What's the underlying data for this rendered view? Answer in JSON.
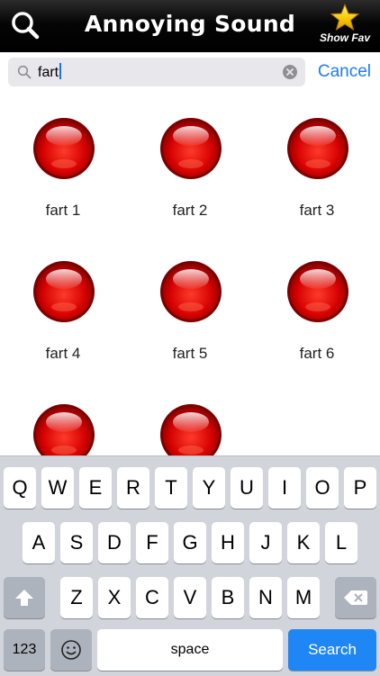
{
  "header": {
    "title": "Annoying Sound",
    "show_fav_label": "Show Fav"
  },
  "search": {
    "value": "fart",
    "cancel_label": "Cancel"
  },
  "sounds": [
    {
      "label": "fart 1"
    },
    {
      "label": "fart 2"
    },
    {
      "label": "fart 3"
    },
    {
      "label": "fart 4"
    },
    {
      "label": "fart 5"
    },
    {
      "label": "fart 6"
    },
    {
      "label": ""
    },
    {
      "label": ""
    }
  ],
  "keyboard": {
    "row1": [
      "Q",
      "W",
      "E",
      "R",
      "T",
      "Y",
      "U",
      "I",
      "O",
      "P"
    ],
    "row2": [
      "A",
      "S",
      "D",
      "F",
      "G",
      "H",
      "J",
      "K",
      "L"
    ],
    "row3": [
      "Z",
      "X",
      "C",
      "V",
      "B",
      "N",
      "M"
    ],
    "numbers_label": "123",
    "space_label": "space",
    "search_label": "Search"
  },
  "colors": {
    "accent": "#1d7cf2",
    "sound_button": "#d40000"
  }
}
